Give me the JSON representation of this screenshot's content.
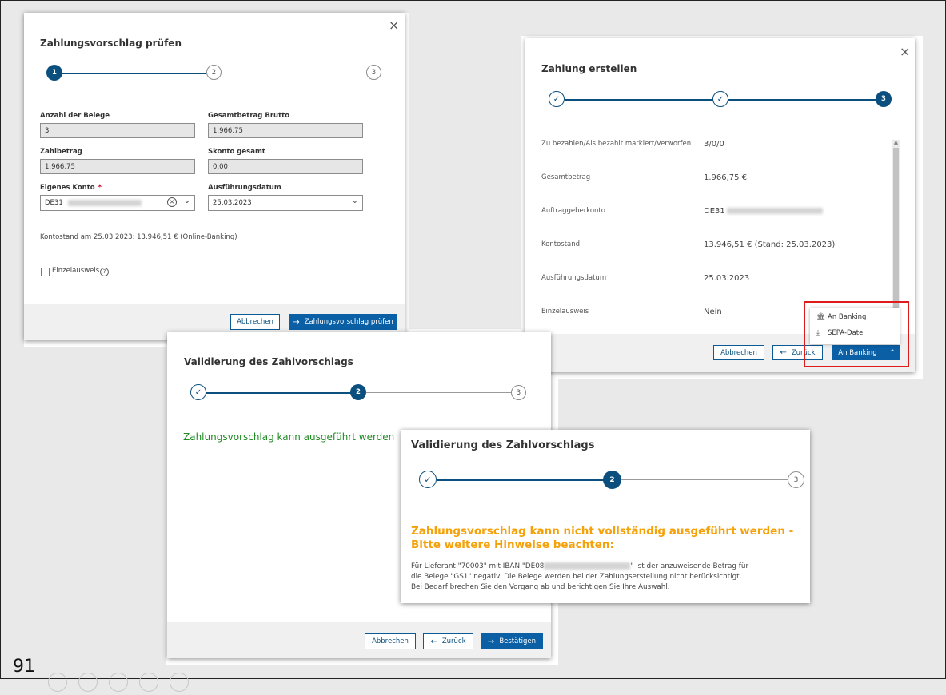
{
  "page_number": "91",
  "dialog1": {
    "title": "Zahlungsvorschlag prüfen",
    "close": "×",
    "steps": [
      "1",
      "2",
      "3"
    ],
    "fields": {
      "anzahl_label": "Anzahl der Belege",
      "anzahl_value": "3",
      "brutto_label": "Gesamtbetrag Brutto",
      "brutto_value": "1.966,75",
      "zahlbetrag_label": "Zahlbetrag",
      "zahlbetrag_value": "1.966,75",
      "skonto_label": "Skonto gesamt",
      "skonto_value": "0,00",
      "konto_label": "Eigenes Konto",
      "konto_required": "*",
      "konto_value": "DE31",
      "datum_label": "Ausführungsdatum",
      "datum_value": "25.03.2023"
    },
    "kontostand": "Kontostand am 25.03.2023: 13.946,51 € (Online-Banking)",
    "einzelausweis_label": "Einzelausweis",
    "help_glyph": "?",
    "cancel_label": "Abbrechen",
    "submit_label": "Zahlungsvorschlag prüfen"
  },
  "dialog2": {
    "title": "Zahlung erstellen",
    "close": "×",
    "step3": "3",
    "check_glyph": "✓",
    "rows": [
      {
        "label": "Zu bezahlen/Als bezahlt markiert/Verworfen",
        "value": "3/0/0"
      },
      {
        "label": "Gesamtbetrag",
        "value": "1.966,75 €"
      },
      {
        "label": "Auftraggeberkonto",
        "value": "DE31"
      },
      {
        "label": "Kontostand",
        "value": "13.946,51 € (Stand: 25.03.2023)"
      },
      {
        "label": "Ausführungsdatum",
        "value": "25.03.2023"
      },
      {
        "label": "Einzelausweis",
        "value": "Nein"
      }
    ],
    "cancel_label": "Abbrechen",
    "back_label": "Zurück",
    "banking_label": "An Banking",
    "menu": [
      "An Banking",
      "SEPA-Datei"
    ]
  },
  "dialog3": {
    "title": "Validierung des Zahlvorschlags",
    "step2": "2",
    "step3": "3",
    "check_glyph": "✓",
    "message": "Zahlungsvorschlag kann ausgeführt werden",
    "cancel_label": "Abbrechen",
    "back_label": "Zurück",
    "confirm_label": "Bestätigen"
  },
  "dialog4": {
    "title": "Validierung des Zahlvorschlags",
    "step2": "2",
    "step3": "3",
    "check_glyph": "✓",
    "warning_line1": "Zahlungsvorschlag kann nicht vollständig ausgeführt werden -",
    "warning_line2": "Bitte weitere Hinweise beachten:",
    "body_prefix": "Für Lieferant \"70003\" mit IBAN \"DE08",
    "body_suffix": "\" ist der anzuweisende Betrag für",
    "body_line2": "die Belege \"GS1\" negativ. Die Belege werden bei der Zahlungserstellung nicht berücksichtigt.",
    "body_line3": "Bei Bedarf brechen Sie den Vorgang ab und berichtigen Sie Ihre Auswahl."
  },
  "colors": {
    "primary": "#0a5fa5",
    "step_active": "#0a4f7e",
    "success": "#1e8a22",
    "warning": "#f5a10a",
    "highlight": "#e01b1b"
  }
}
